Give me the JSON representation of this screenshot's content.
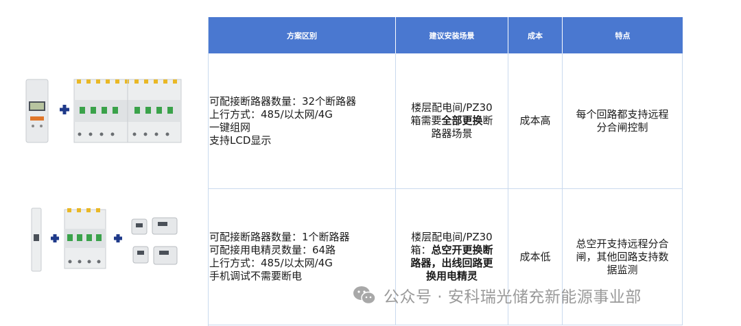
{
  "table": {
    "headers": [
      "方案区别",
      "建议安装场景",
      "成本",
      "特点"
    ],
    "rows": [
      {
        "scheme": [
          "可配接断路器数量：32个断路器",
          "上行方式：485/以太网/4G",
          "一键组网",
          "支持LCD显示"
        ],
        "scene_parts": [
          {
            "text": "楼层配电间/PZ30",
            "bold": false
          },
          {
            "text": "箱需要",
            "bold": false
          },
          {
            "text": "全部更换",
            "bold": true
          },
          {
            "text": "断",
            "bold": false
          },
          {
            "text": "路器场景",
            "bold": false
          }
        ],
        "cost": "成本高",
        "feature": [
          "每个回路都支持远程",
          "分合闸控制"
        ]
      },
      {
        "scheme": [
          "可配接断路器数量：1个断路器",
          "可配接用电精灵数量：64路",
          "上行方式：485/以太网/4G",
          "手机调试不需要断电"
        ],
        "scene_parts": [
          {
            "text": "楼层配电间/PZ30",
            "bold": false
          },
          {
            "text": "箱：",
            "bold": false
          },
          {
            "text": "总空开更换断",
            "bold": true
          },
          {
            "text": "路器，出线回路更",
            "bold": true
          },
          {
            "text": "换用电精灵",
            "bold": true
          }
        ],
        "cost": "成本低",
        "feature": [
          "总空开支持远程分合",
          "闸，其他回路支持数",
          "据监测"
        ]
      }
    ]
  },
  "watermark": "公众号 · 安科瑞光储充新能源事业部",
  "images": [
    {
      "name": "product-group-1",
      "alt": "meter + circuit breakers"
    },
    {
      "name": "product-group-2",
      "alt": "meter + breakers + power sensors"
    }
  ],
  "colors": {
    "header_bg": "#4a78d0",
    "plus": "#1f3a8a",
    "border": "#c9d9ee"
  }
}
